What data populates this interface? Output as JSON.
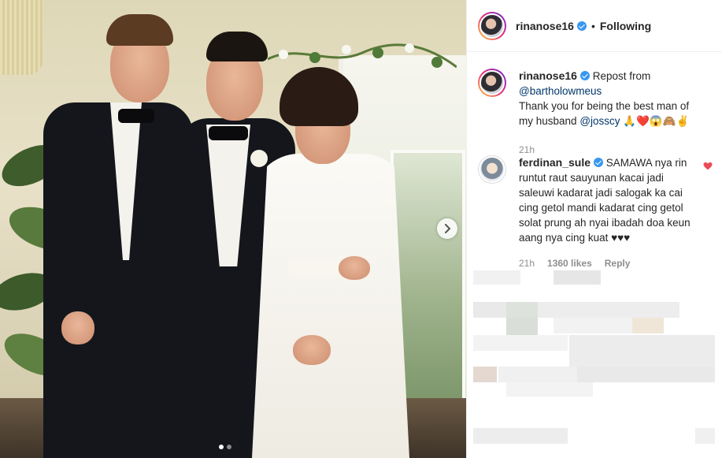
{
  "post": {
    "author": "rinanose16",
    "follow_state": "Following",
    "separator": "•",
    "carousel": {
      "dots": 2,
      "active_index": 0
    }
  },
  "caption": {
    "author": "rinanose16",
    "repost_prefix": "Repost from",
    "repost_handle": "@bartholowmeus",
    "text_before": "Thank you for being the best man of my husband",
    "mention": "@josscy",
    "emojis": "🙏❤️😱🙈✌️",
    "time": "21h"
  },
  "comments": [
    {
      "author": "ferdinan_sule",
      "text": "SAMAWA nya rin runtut raut sauyunan kacai jadi saleuwi kadarat jadi salogak ka cai cing getol mandi kadarat cing getol solat prung ah nyai ibadah doa keun aang nya cing kuat ♥♥♥",
      "time": "21h",
      "likes": "1360 likes",
      "reply": "Reply"
    }
  ],
  "icons": {
    "verified": "verified-badge-icon",
    "heart": "heart-icon",
    "next": "chevron-right-icon"
  },
  "colors": {
    "accent_blue": "#3897f0",
    "mention": "#00376b",
    "heart_liked": "#ed4956",
    "muted": "#8e8e8e"
  }
}
